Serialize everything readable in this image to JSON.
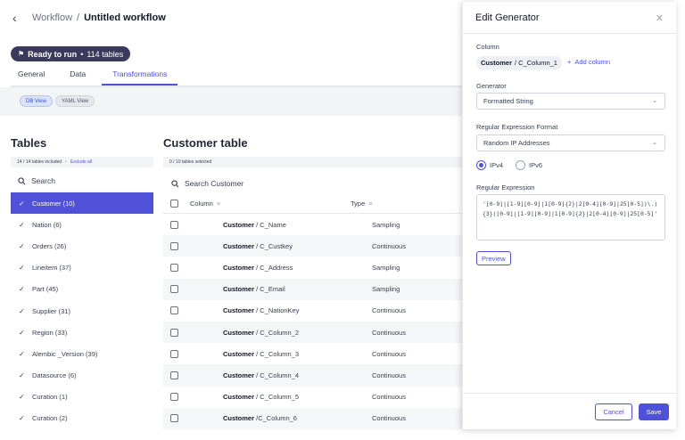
{
  "header": {
    "back_icon": "chevron-left-icon",
    "breadcrumb_root": "Workflow",
    "breadcrumb_sep": "/",
    "title": "Untitled workflow"
  },
  "status": {
    "label": "Ready to run",
    "sep": "•",
    "tables": "114 tables"
  },
  "tabs": [
    {
      "label": "General",
      "active": false
    },
    {
      "label": "Data",
      "active": false
    },
    {
      "label": "Transformations",
      "active": true
    }
  ],
  "views": {
    "db": "DB View",
    "yaml": "YAML View"
  },
  "tables_panel": {
    "title": "Tables",
    "included": "14 / 14 tables included",
    "sep": "•",
    "exclude_all": "Exclude all",
    "search_label": "Search",
    "items": [
      {
        "label": "Customer (10)",
        "selected": true
      },
      {
        "label": "Nation (6)",
        "selected": false
      },
      {
        "label": "Orders (26)",
        "selected": false
      },
      {
        "label": "Lineitem (37)",
        "selected": false
      },
      {
        "label": "Part (45)",
        "selected": false
      },
      {
        "label": "Supplier (31)",
        "selected": false
      },
      {
        "label": "Region (33)",
        "selected": false
      },
      {
        "label": "Alembic _Version (39)",
        "selected": false
      },
      {
        "label": "Datasource (6)",
        "selected": false
      },
      {
        "label": "Curation (1)",
        "selected": false
      },
      {
        "label": "Curation (2)",
        "selected": false
      }
    ]
  },
  "customer_table": {
    "title": "Customer table",
    "selected_count": "0 / 10 tables selected",
    "search_label": "Search Customer",
    "col_column": "Column",
    "col_type": "Type",
    "rows": [
      {
        "table": "Customer",
        "column": "/ C_Name",
        "type": "Sampling"
      },
      {
        "table": "Customer",
        "column": "/ C_Custkey",
        "type": "Continuous"
      },
      {
        "table": "Customer",
        "column": "/ C_Address",
        "type": "Sampling"
      },
      {
        "table": "Customer",
        "column": "/ C_Email",
        "type": "Sampling"
      },
      {
        "table": "Customer",
        "column": "/ C_NationKey",
        "type": "Continuous"
      },
      {
        "table": "Customer",
        "column": "/ C_Column_2",
        "type": "Continuous"
      },
      {
        "table": "Customer",
        "column": "/ C_Column_3",
        "type": "Continuous"
      },
      {
        "table": "Customer",
        "column": "/ C_Column_4",
        "type": "Continuous"
      },
      {
        "table": "Customer",
        "column": "/ C_Column_5",
        "type": "Continuous"
      },
      {
        "table": "Customer",
        "column": "/C_Column_6",
        "type": "Continuous"
      }
    ]
  },
  "drawer": {
    "title": "Edit Generator",
    "column_label": "Column",
    "column_table": "Customer",
    "column_name": "/ C_Column_1",
    "add_column": "Add column",
    "generator_label": "Generator",
    "generator_value": "Formatted String",
    "format_label": "Regular Expression Format",
    "format_value": "Random IP Addresses",
    "ipv4": "IPv4",
    "ipv6": "IPv6",
    "ip_selected": "IPv4",
    "regex_label": "Regular Expression",
    "regex_value": "'[0-9]|[1-9][0-9]|1[0-9]{2}|2[0-4][0-9]|25[0-5])\\.){3}([0-9]|[1-9][0-9]|1[0-9]{2}|2[0-4][0-9]|25[0-5]'",
    "preview": "Preview",
    "cancel": "Cancel",
    "save": "Save"
  }
}
